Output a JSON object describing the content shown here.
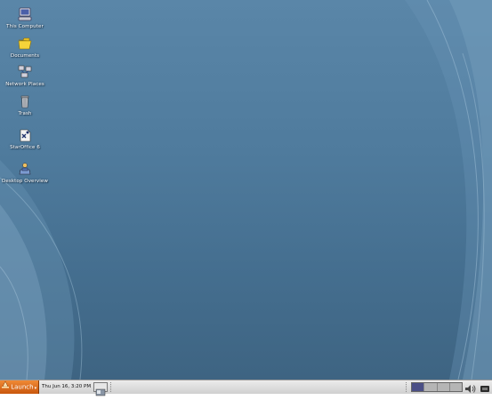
{
  "desktop": {
    "icons": [
      {
        "label": "This Computer",
        "icon": "computer-icon"
      },
      {
        "label": "Documents",
        "icon": "folder-icon"
      },
      {
        "label": "Network Places",
        "icon": "network-icon"
      },
      {
        "label": "Trash",
        "icon": "trash-icon"
      },
      {
        "label": "StarOffice 6",
        "icon": "staroffice-icon"
      },
      {
        "label": "Desktop Overview",
        "icon": "desktop-overview-icon"
      }
    ]
  },
  "taskbar": {
    "launch_label": "Launch",
    "clock": "Thu Jun 16,  3:20 PM",
    "workspaces": 4,
    "active_workspace": 1
  },
  "colors": {
    "desktop": "#4f7b9d",
    "launch": "#e0731f",
    "active_workspace": "#4b4f86"
  }
}
